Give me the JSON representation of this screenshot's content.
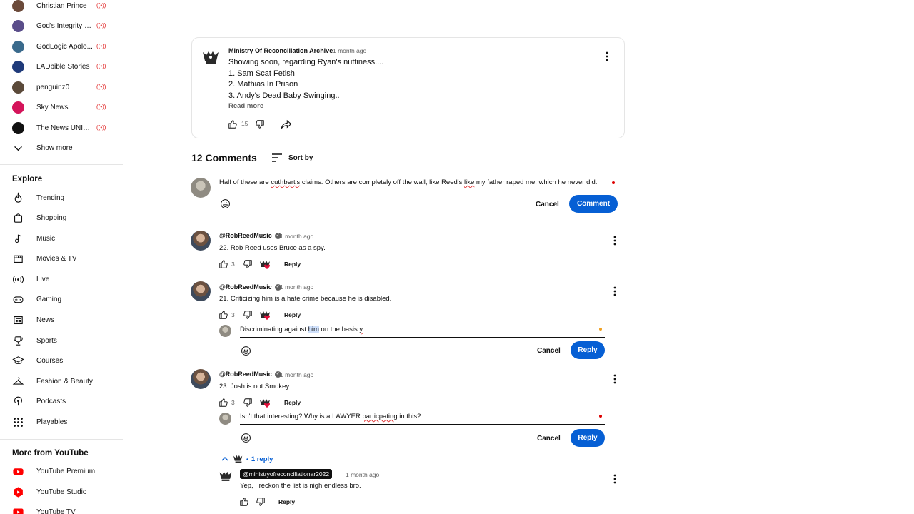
{
  "sidebar": {
    "subscriptions": [
      {
        "name": "Christian Prince",
        "color": "#6b4a3a"
      },
      {
        "name": "God's Integrity P...",
        "color": "#5a4d8a"
      },
      {
        "name": "GodLogic Apolo...",
        "color": "#3a6a8c"
      },
      {
        "name": "LADbible Stories",
        "color": "#1f3a7a"
      },
      {
        "name": "penguinz0",
        "color": "#5b4a3a"
      },
      {
        "name": "Sky News",
        "color": "#d4145a"
      },
      {
        "name": "The News UNIT ...",
        "color": "#111111"
      }
    ],
    "show_more": "Show more",
    "explore_title": "Explore",
    "explore": [
      {
        "label": "Trending",
        "icon": "trending-icon"
      },
      {
        "label": "Shopping",
        "icon": "shopping-icon"
      },
      {
        "label": "Music",
        "icon": "music-icon"
      },
      {
        "label": "Movies & TV",
        "icon": "movies-icon"
      },
      {
        "label": "Live",
        "icon": "live-icon"
      },
      {
        "label": "Gaming",
        "icon": "gaming-icon"
      },
      {
        "label": "News",
        "icon": "news-icon"
      },
      {
        "label": "Sports",
        "icon": "sports-icon"
      },
      {
        "label": "Courses",
        "icon": "courses-icon"
      },
      {
        "label": "Fashion & Beauty",
        "icon": "fashion-icon"
      },
      {
        "label": "Podcasts",
        "icon": "podcasts-icon"
      },
      {
        "label": "Playables",
        "icon": "playables-icon"
      }
    ],
    "more_title": "More from YouTube",
    "more": [
      {
        "label": "YouTube Premium"
      },
      {
        "label": "YouTube Studio"
      },
      {
        "label": "YouTube TV"
      }
    ]
  },
  "post": {
    "author": "Ministry Of Reconciliation Archive",
    "time": "1 month ago",
    "lines": [
      "Showing soon, regarding Ryan's nuttiness....",
      "1. Sam Scat Fetish",
      "2. Mathias In Prison",
      "3. Andy's Dead Baby Swinging.."
    ],
    "read_more": "Read more",
    "likes": "15"
  },
  "comments_header": {
    "count": "12 Comments",
    "sort_label": "Sort by"
  },
  "new_comment": {
    "parts": [
      "Half of these are ",
      "cuthbert's",
      " claims. Others are completely off the wall, like Reed's ",
      "like",
      " my father raped me, which he never did."
    ],
    "cancel": "Cancel",
    "submit": "Comment"
  },
  "comments": [
    {
      "author": "@RobReedMusic",
      "time": "1 month ago",
      "text": "22. Rob Reed uses Bruce as a spy.",
      "likes": "3",
      "reply": "Reply"
    },
    {
      "author": "@RobReedMusic",
      "time": "1 month ago",
      "text": "21. Criticizing him is a hate crime because he is disabled.",
      "likes": "3",
      "reply": "Reply"
    },
    {
      "author": "@RobReedMusic",
      "time": "1 month ago",
      "text": "23. Josh is not Smokey.",
      "likes": "3",
      "reply": "Reply"
    }
  ],
  "reply_box_1": {
    "before": "Discriminating against ",
    "selected": "him",
    "after": " on the basis ",
    "tail": "y",
    "cancel": "Cancel",
    "submit": "Reply"
  },
  "reply_box_2": {
    "before": "Isn't that interesting? Why is a LAWYER ",
    "misspelled": "particpating",
    "after": " in this?",
    "cancel": "Cancel",
    "submit": "Reply"
  },
  "replies_toggle": {
    "label": "1 reply"
  },
  "nested_reply": {
    "handle": "@ministryofreconciliationar2022",
    "time": "1 month ago",
    "text": "Yep, I reckon the list is nigh endless bro.",
    "reply": "Reply"
  }
}
